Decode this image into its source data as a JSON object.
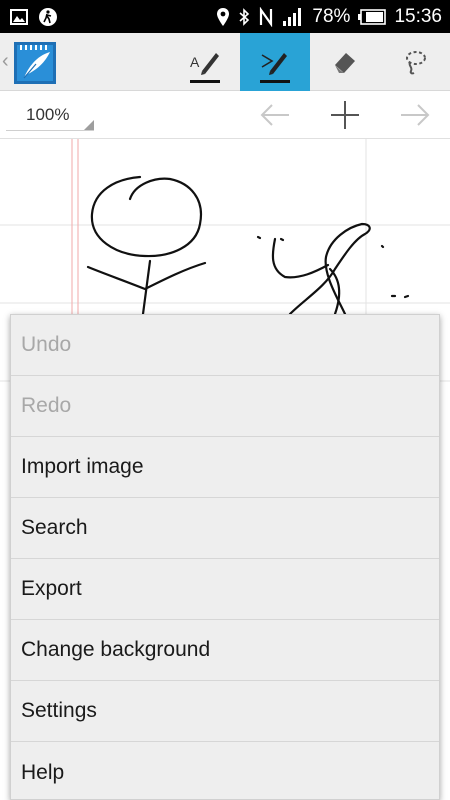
{
  "status_bar": {
    "battery_percent": "78%",
    "time": "15:36",
    "icons": [
      "image-icon",
      "accessibility-icon",
      "location-icon",
      "bluetooth-icon",
      "nfc-icon",
      "signal-icon",
      "battery-icon"
    ]
  },
  "action_bar": {
    "tools": [
      {
        "name": "text-pen-tool",
        "icon": "text-pen-icon",
        "active": false
      },
      {
        "name": "pen-tool",
        "icon": "pen-icon",
        "active": true
      },
      {
        "name": "eraser-tool",
        "icon": "eraser-icon",
        "active": false
      },
      {
        "name": "lasso-tool",
        "icon": "lasso-icon",
        "active": false
      }
    ],
    "active_color": "#29a3d6"
  },
  "toolbar": {
    "zoom": "100%"
  },
  "menu": {
    "items": [
      {
        "label": "Undo",
        "enabled": false
      },
      {
        "label": "Redo",
        "enabled": false
      },
      {
        "label": "Import image",
        "enabled": true
      },
      {
        "label": "Search",
        "enabled": true
      },
      {
        "label": "Export",
        "enabled": true
      },
      {
        "label": "Change background",
        "enabled": true
      },
      {
        "label": "Settings",
        "enabled": true
      },
      {
        "label": "Help",
        "enabled": true
      }
    ]
  }
}
